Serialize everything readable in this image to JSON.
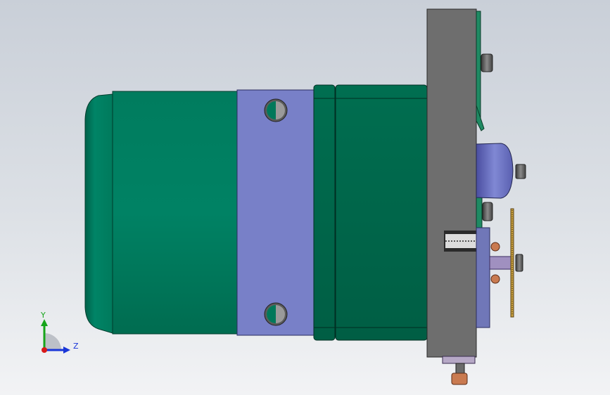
{
  "viewport": {
    "description_hidden": "",
    "colors": {
      "motor_green": "#00785a",
      "motor_green_dark": "#006246",
      "flange_blue": "#7880c8",
      "plate_gray": "#6e6e6e",
      "accent_green": "#1f8a63"
    }
  },
  "triad": {
    "y_label": "Y",
    "z_label": "Z",
    "colors": {
      "y": "#16a51a",
      "z": "#1a36d8",
      "x": "#d81a1a"
    }
  },
  "icons": {
    "triad": "coordinate-triad-icon"
  }
}
